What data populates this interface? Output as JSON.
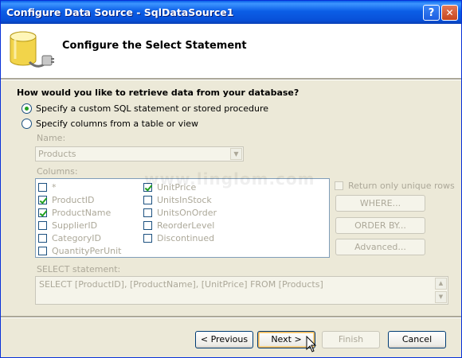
{
  "window": {
    "title": "Configure Data Source - SqlDataSource1",
    "help_glyph": "?",
    "close_glyph": "✕"
  },
  "header": {
    "title": "Configure the Select Statement",
    "icon": "database-plug-icon"
  },
  "question": "How would you like to retrieve data from your database?",
  "options": [
    {
      "label": "Specify a custom SQL statement or stored procedure",
      "selected": true
    },
    {
      "label": "Specify columns from a table or view",
      "selected": false
    }
  ],
  "name_field": {
    "label": "Name:",
    "value": "Products"
  },
  "columns": {
    "label": "Columns:",
    "items": [
      {
        "label": "*",
        "checked": false
      },
      {
        "label": "ProductID",
        "checked": true
      },
      {
        "label": "ProductName",
        "checked": true
      },
      {
        "label": "SupplierID",
        "checked": false
      },
      {
        "label": "CategoryID",
        "checked": false
      },
      {
        "label": "QuantityPerUnit",
        "checked": false
      },
      {
        "label": "UnitPrice",
        "checked": true
      },
      {
        "label": "UnitsInStock",
        "checked": false
      },
      {
        "label": "UnitsOnOrder",
        "checked": false
      },
      {
        "label": "ReorderLevel",
        "checked": false
      },
      {
        "label": "Discontinued",
        "checked": false
      }
    ]
  },
  "unique_rows": {
    "label": "Return only unique rows",
    "checked": false
  },
  "side_buttons": {
    "where": "WHERE...",
    "order_by": "ORDER BY...",
    "advanced": "Advanced..."
  },
  "select_statement": {
    "label": "SELECT statement:",
    "value": "SELECT [ProductID], [ProductName], [UnitPrice] FROM [Products]"
  },
  "buttons": {
    "previous": "< Previous",
    "next": "Next >",
    "finish": "Finish",
    "cancel": "Cancel"
  },
  "watermark": "www.linglom.com",
  "colors": {
    "titlebar": "#0a5fe8",
    "dialog_bg": "#ece9d8",
    "disabled_text": "#aca899",
    "radio_dot": "#21a121"
  }
}
